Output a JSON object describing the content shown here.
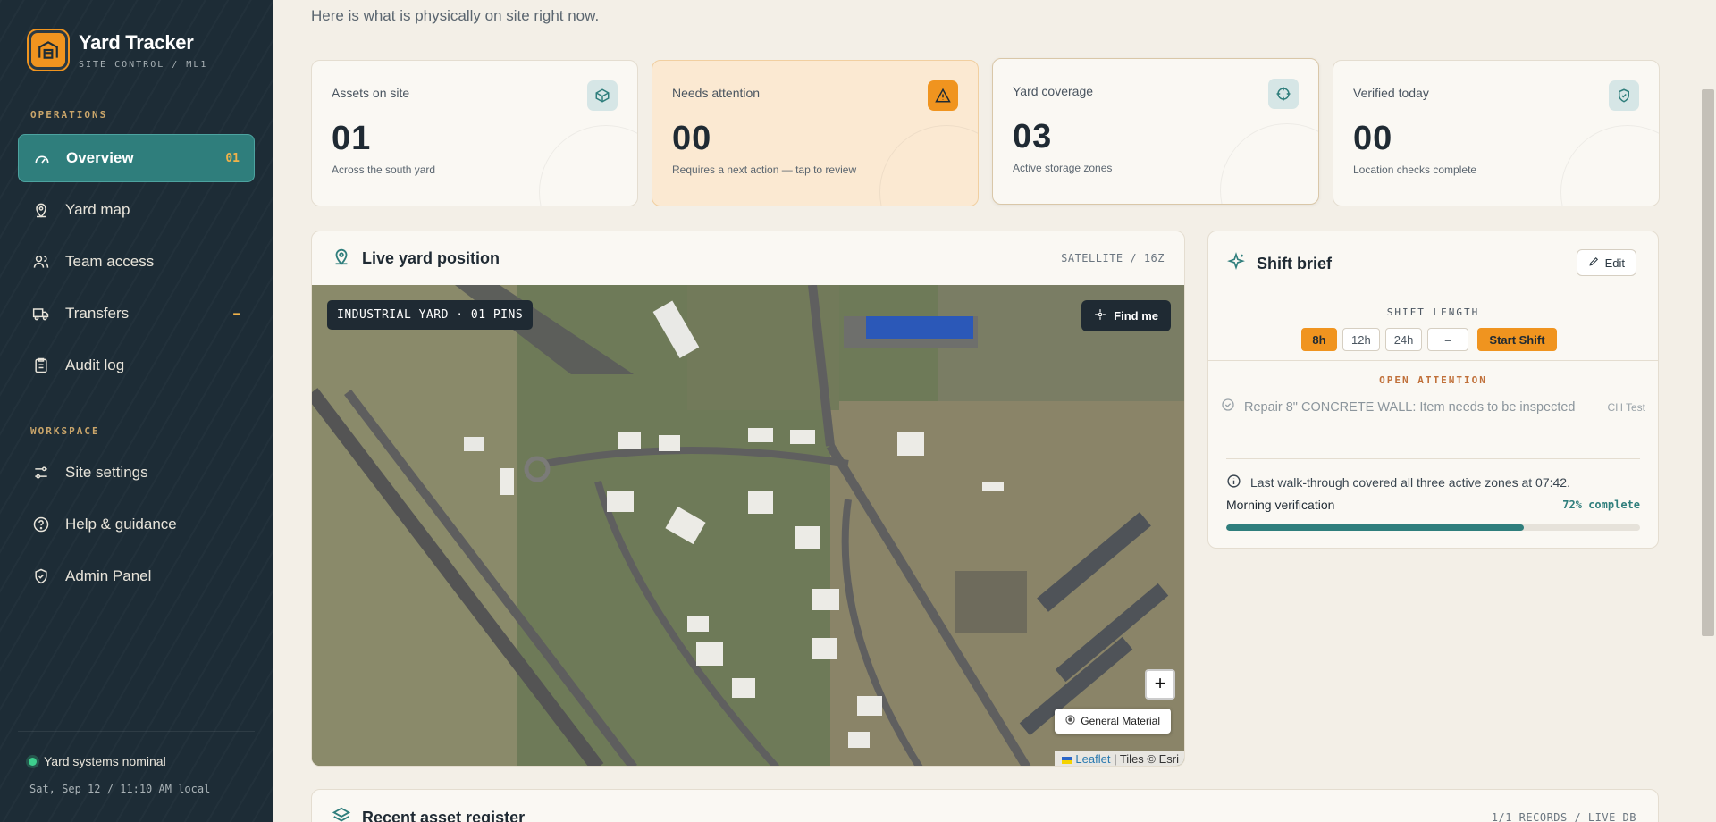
{
  "brand": {
    "title": "Yard Tracker",
    "subtitle": "SITE CONTROL / ML1"
  },
  "sidebar": {
    "operations_label": "OPERATIONS",
    "workspace_label": "WORKSPACE",
    "operations": [
      {
        "label": "Overview",
        "badge": "01",
        "icon": "gauge-icon",
        "active": true
      },
      {
        "label": "Yard map",
        "icon": "map-pin-icon"
      },
      {
        "label": "Team access",
        "icon": "users-icon"
      },
      {
        "label": "Transfers",
        "badge": "–",
        "icon": "truck-icon"
      },
      {
        "label": "Audit log",
        "icon": "clipboard-icon"
      }
    ],
    "workspace": [
      {
        "label": "Site settings",
        "icon": "sliders-icon"
      },
      {
        "label": "Help & guidance",
        "icon": "help-icon"
      },
      {
        "label": "Admin Panel",
        "icon": "shield-icon"
      }
    ],
    "status": "Yard systems nominal",
    "datetime": "Sat, Sep 12 / 11:10 AM local"
  },
  "intro": "Here is what is physically on site right now.",
  "stats": [
    {
      "label": "Assets on site",
      "value": "01",
      "caption": "Across the south yard",
      "icon": "box-icon"
    },
    {
      "label": "Needs attention",
      "value": "00",
      "caption": "Requires a next action — tap to review",
      "icon": "warning-icon"
    },
    {
      "label": "Yard coverage",
      "value": "03",
      "caption": "Active storage zones",
      "icon": "crosshair-icon"
    },
    {
      "label": "Verified today",
      "value": "00",
      "caption": "Location checks complete",
      "icon": "shield-check-icon"
    }
  ],
  "map": {
    "title": "Live yard position",
    "meta": "SATELLITE / 16Z",
    "chip": "INDUSTRIAL YARD · 01 PINS",
    "find_label": "Find me",
    "zoom_in": "+",
    "layer_label": "General Material",
    "attrib_leaflet": "Leaflet",
    "attrib_tiles": "| Tiles © Esri"
  },
  "brief": {
    "title": "Shift brief",
    "edit_label": "Edit",
    "shift_length_label": "SHIFT LENGTH",
    "options": [
      "8h",
      "12h",
      "24h",
      "–"
    ],
    "selected": "8h",
    "start_label": "Start Shift",
    "open_attention_label": "OPEN ATTENTION",
    "attention_item": "Repair 8\" CONCRETE WALL: Item needs to be inspected",
    "attention_meta": "CH Test",
    "note": "Last walk-through covered all three active zones at 07:42.",
    "verification_label": "Morning verification",
    "verification_pct_text": "72% complete",
    "verification_pct": 0.72
  },
  "register": {
    "title": "Recent asset register",
    "meta": "1/1 RECORDS / LIVE DB"
  },
  "colors": {
    "accent": "#f0941f",
    "teal": "#2f7e7c",
    "sidebar": "#1d2c36"
  }
}
